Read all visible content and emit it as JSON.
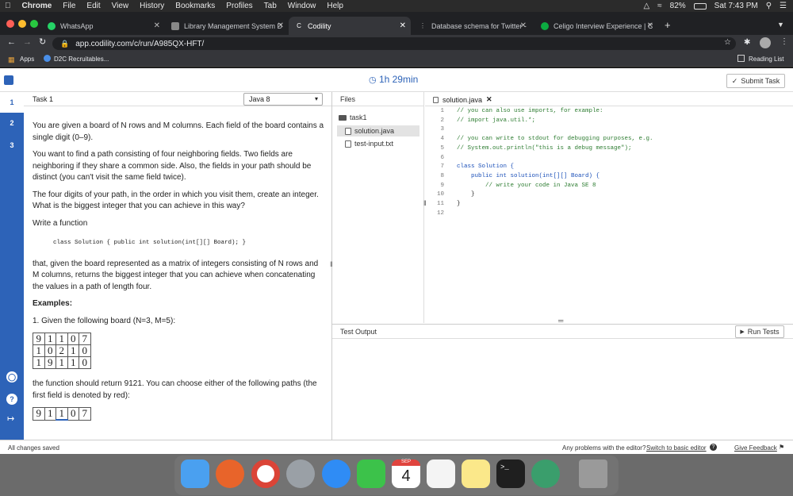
{
  "menubar": {
    "apple": "",
    "app": "Chrome",
    "items": [
      "File",
      "Edit",
      "View",
      "History",
      "Bookmarks",
      "Profiles",
      "Tab",
      "Window",
      "Help"
    ],
    "battery": "82%",
    "clock": "Sat 7:43 PM"
  },
  "tabs": [
    {
      "label": "WhatsApp",
      "icon": "whatsapp-icon",
      "color": "#25d366"
    },
    {
      "label": "Library Management System D",
      "icon": "page-icon",
      "color": "#888888"
    },
    {
      "label": "Codility",
      "icon": "codility-icon",
      "color": "#ffffff"
    },
    {
      "label": "Database schema for Twitter -",
      "icon": "dots-icon",
      "color": "#aaaaaa"
    },
    {
      "label": "Celigo Interview Experience | C",
      "icon": "glassdoor-icon",
      "color": "#0caa41"
    }
  ],
  "toolbar": {
    "url": "app.codility.com/c/run/A985QX-HFT/"
  },
  "bookmarks": {
    "apps": "Apps",
    "d2c": "D2C Recruitables...",
    "reading_list": "Reading List"
  },
  "header": {
    "timer": "1h 29min",
    "submit": "Submit Task"
  },
  "nav": {
    "items": [
      "1",
      "2",
      "3"
    ]
  },
  "task": {
    "title": "Task 1",
    "language": "Java 8",
    "p1": "You are given a board of N rows and M columns. Each field of the board contains a single digit (0–9).",
    "p2": "You want to find a path consisting of four neighboring fields. Two fields are neighboring if they share a common side. Also, the fields in your path should be distinct (you can't visit the same field twice).",
    "p3": "The four digits of your path, in the order in which you visit them, create an integer. What is the biggest integer that you can achieve in this way?",
    "p4": "Write a function",
    "signature": "class Solution { public int solution(int[][] Board); }",
    "p5": "that, given the board represented as a matrix of integers consisting of N rows and M columns, returns the biggest integer that you can achieve when concatenating the values in a path of length four.",
    "examples_heading": "Examples:",
    "example1": "1. Given the following board (N=3, M=5):",
    "board": [
      [
        9,
        1,
        1,
        0,
        7
      ],
      [
        1,
        0,
        2,
        1,
        0
      ],
      [
        1,
        9,
        1,
        1,
        0
      ]
    ],
    "p6": "the function should return 9121. You can choose either of the following paths (the first field is denoted by red):",
    "board2_row": [
      9,
      1,
      1,
      0,
      7
    ]
  },
  "files": {
    "header": "Files",
    "folder": "task1",
    "items": [
      "solution.java",
      "test-input.txt"
    ]
  },
  "editor": {
    "tab": "solution.java",
    "lines": [
      "// you can also use imports, for example:",
      "// import java.util.*;",
      "",
      "// you can write to stdout for debugging purposes, e.g.",
      "// System.out.println(\"this is a debug message\");",
      "",
      "class Solution {",
      "    public int solution(int[][] Board) {",
      "        // write your code in Java SE 8",
      "    }",
      "}",
      ""
    ]
  },
  "output": {
    "title": "Test Output",
    "run": "Run Tests"
  },
  "status": {
    "saved": "All changes saved",
    "problems": "Any problems with the editor?",
    "switch_link": "Switch to basic editor",
    "feedback": "Give Feedback"
  },
  "dock": {
    "calendar_month": "SEP",
    "calendar_day": "4",
    "apps": [
      "finder-icon",
      "firefox-icon",
      "chrome-icon",
      "launchpad-icon",
      "safari-icon",
      "facetime-icon",
      "calendar-icon",
      "reminders-icon",
      "notes-icon",
      "terminal-icon",
      "network-icon",
      "trash-icon"
    ]
  }
}
